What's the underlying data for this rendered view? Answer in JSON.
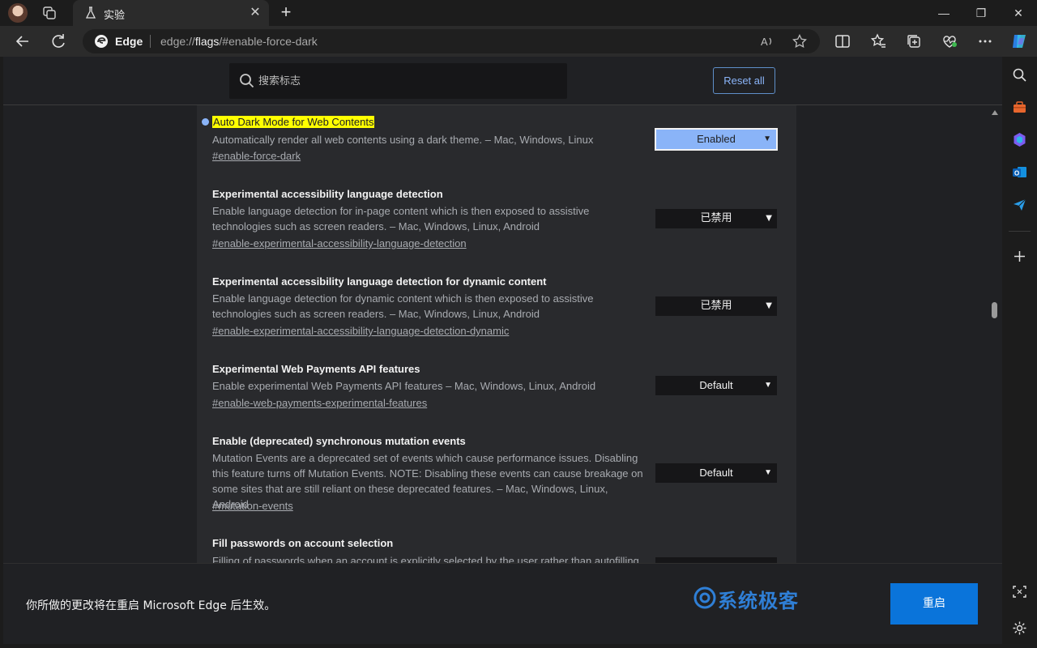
{
  "tab": {
    "title": "实验",
    "close": "✕"
  },
  "window": {
    "minimize": "—",
    "restore": "❐",
    "close": "✕"
  },
  "omnibox": {
    "brand": "Edge",
    "url_prefix": "edge://",
    "url_host": "flags",
    "url_rest": "/#enable-force-dark"
  },
  "search": {
    "placeholder": "搜索标志"
  },
  "reset_label": "Reset all",
  "flags": [
    {
      "title": "Auto Dark Mode for Web Contents",
      "highlighted": true,
      "modified": true,
      "description": "Automatically render all web contents using a dark theme. – Mac, Windows, Linux",
      "link": "#enable-force-dark",
      "value": "Enabled"
    },
    {
      "title": "Experimental accessibility language detection",
      "description": "Enable language detection for in-page content which is then exposed to assistive technologies such as screen readers. – Mac, Windows, Linux, Android",
      "link": "#enable-experimental-accessibility-language-detection",
      "value": "已禁用"
    },
    {
      "title": "Experimental accessibility language detection for dynamic content",
      "description": "Enable language detection for dynamic content which is then exposed to assistive technologies such as screen readers. – Mac, Windows, Linux, Android",
      "link": "#enable-experimental-accessibility-language-detection-dynamic",
      "value": "已禁用"
    },
    {
      "title": "Experimental Web Payments API features",
      "description": "Enable experimental Web Payments API features – Mac, Windows, Linux, Android",
      "link": "#enable-web-payments-experimental-features",
      "value": "Default"
    },
    {
      "title": "Enable (deprecated) synchronous mutation events",
      "description": "Mutation Events are a deprecated set of events which cause performance issues. Disabling this feature turns off Mutation Events. NOTE: Disabling these events can cause breakage on some sites that are still reliant on these deprecated features. – Mac, Windows, Linux, Android",
      "link": "#mutation-events",
      "value": "Default"
    },
    {
      "title": "Fill passwords on account selection",
      "description": "Filling of passwords when an account is explicitly selected by the user rather than autofilling"
    }
  ],
  "restart": {
    "message": "你所做的更改将在重启 Microsoft Edge 后生效。",
    "button": "重启"
  },
  "watermark": "系统极客",
  "colors": {
    "accent": "#8ab4f8",
    "highlight": "#ffff00",
    "restart_button": "#0a74da"
  }
}
